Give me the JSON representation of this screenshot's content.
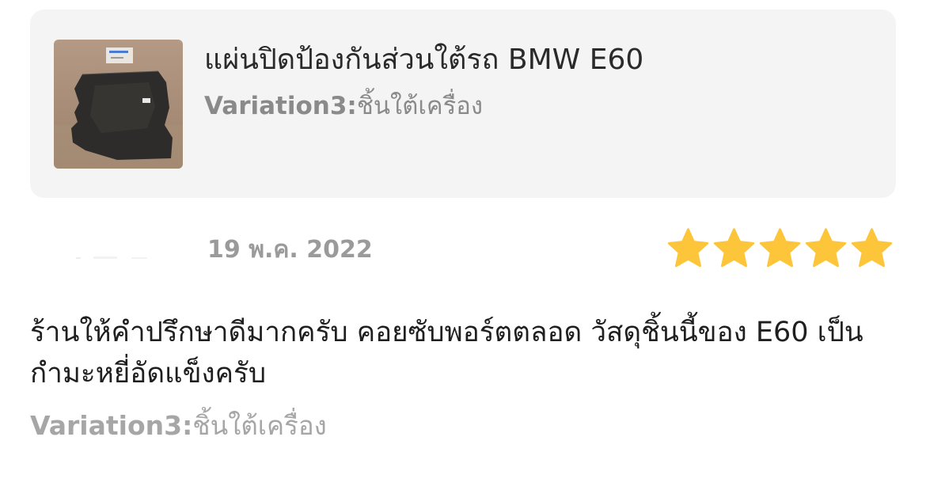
{
  "product": {
    "title": "แผ่นปิดป้องกันส่วนใต้รถ BMW E60",
    "variation_key": "Variation3:",
    "variation_value": "ชิ้นใต้เครื่อง",
    "thumbnail_icon": "product-photo-underbody-cover"
  },
  "review": {
    "date": "19 พ.ค. 2022",
    "rating": 5,
    "rating_max": 5,
    "star_color": "#fcc53a",
    "text": "ร้านให้คำปรึกษาดีมากครับ คอยซับพอร์ตตลอด วัสดุชิ้นนี้ของ E60 เป็นกำมะหยี่อัดแข็งครับ",
    "variation_key": "Variation3:",
    "variation_value": "ชิ้นใต้เครื่อง"
  },
  "colors": {
    "card_background": "#f4f4f4",
    "muted_text": "#8a8a8a"
  }
}
